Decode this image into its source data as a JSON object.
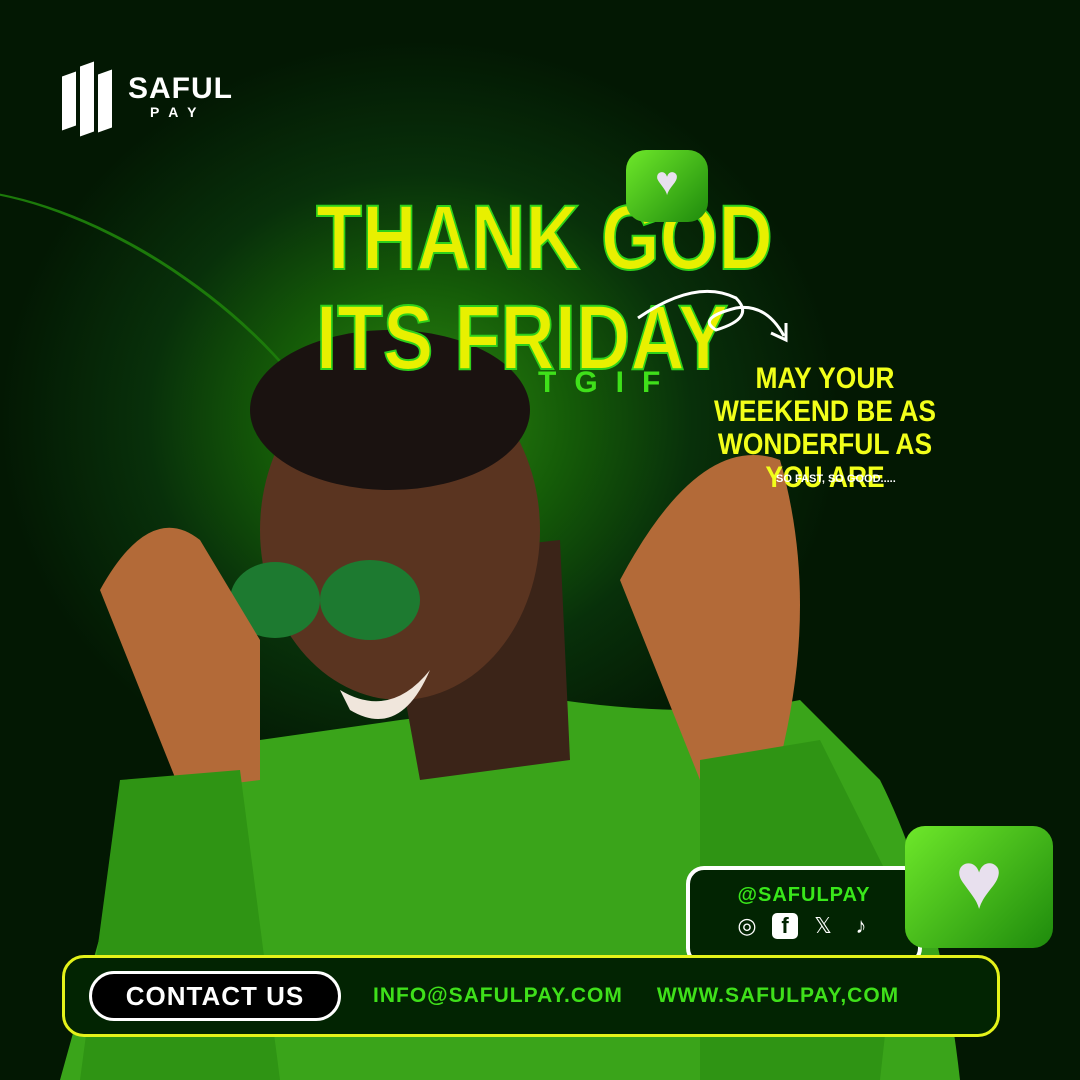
{
  "brand": {
    "name": "SAFUL",
    "sub": "PAY"
  },
  "headline": {
    "line1": "THANK GOD",
    "line2": "ITS FRIDAY",
    "tag": "TGIF"
  },
  "message": {
    "text": "MAY YOUR WEEKEND BE AS WONDERFUL AS YOU ARE",
    "sub": "SO FAST, SO GOOD....."
  },
  "social": {
    "handle": "@SAFULPAY",
    "icons": [
      "instagram-icon",
      "facebook-icon",
      "x-icon",
      "tiktok-icon"
    ]
  },
  "footer": {
    "contact_label": "CONTACT US",
    "email": "INFO@SAFULPAY.COM",
    "website": "WWW.SAFULPAY,COM"
  },
  "colors": {
    "accent": "#3fe01a",
    "yellow": "#e8f000",
    "bg": "#041a04"
  }
}
